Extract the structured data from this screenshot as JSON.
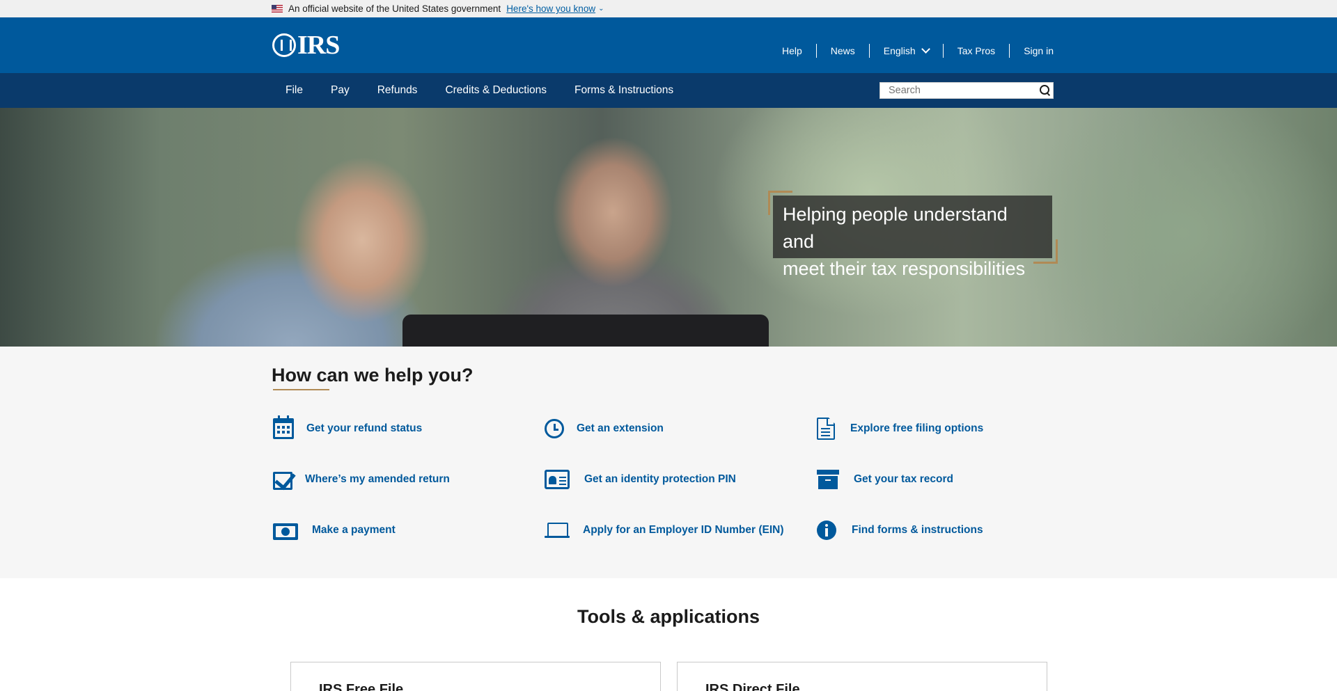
{
  "gov_banner": {
    "text": "An official website of the United States government",
    "link": "Here's how you know"
  },
  "header": {
    "logo_text": "IRS",
    "util_nav": [
      "Help",
      "News",
      "English",
      "Tax Pros",
      "Sign in"
    ]
  },
  "main_nav": {
    "items": [
      "File",
      "Pay",
      "Refunds",
      "Credits & Deductions",
      "Forms & Instructions"
    ],
    "search_placeholder": "Search"
  },
  "hero": {
    "headline_line1": "Helping people understand and",
    "headline_line2": "meet their tax responsibilities"
  },
  "help": {
    "title": "How can we help you?",
    "items": [
      {
        "label": "Get your refund status",
        "icon": "calendar-icon"
      },
      {
        "label": "Get an extension",
        "icon": "clock-icon"
      },
      {
        "label": "Explore free filing options",
        "icon": "document-icon"
      },
      {
        "label": "Where’s my amended return",
        "icon": "checkbox-icon"
      },
      {
        "label": "Get an identity protection PIN",
        "icon": "id-card-icon"
      },
      {
        "label": "Get your tax record",
        "icon": "archive-icon"
      },
      {
        "label": "Make a payment",
        "icon": "money-icon"
      },
      {
        "label": "Apply for an Employer ID Number (EIN)",
        "icon": "laptop-icon"
      },
      {
        "label": "Find forms & instructions",
        "icon": "info-icon"
      }
    ]
  },
  "tools": {
    "title": "Tools & applications",
    "cards": [
      "IRS Free File",
      "IRS Direct File"
    ]
  },
  "colors": {
    "header_blue": "#00599c",
    "nav_dark_blue": "#0a3a6b",
    "accent_gold": "#b08a55",
    "link_blue": "#00599c"
  }
}
